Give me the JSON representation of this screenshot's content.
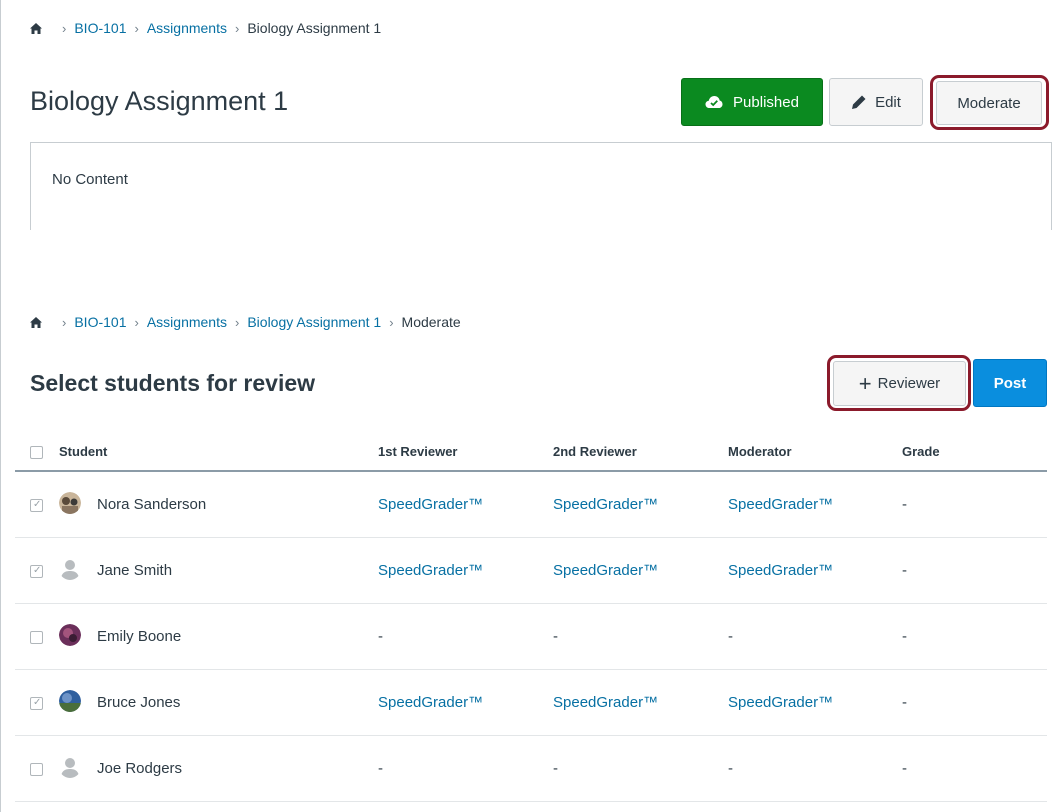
{
  "breadcrumb_top": {
    "items": [
      "BIO-101",
      "Assignments"
    ],
    "current": "Biology Assignment 1"
  },
  "assignment": {
    "title": "Biology Assignment 1",
    "published_label": "Published",
    "edit_label": "Edit",
    "moderate_label": "Moderate",
    "content_text": "No Content"
  },
  "breadcrumb_bottom": {
    "items": [
      "BIO-101",
      "Assignments",
      "Biology Assignment 1"
    ],
    "current": "Moderate"
  },
  "moderate_page": {
    "title": "Select students for review",
    "reviewer_label": "Reviewer",
    "post_label": "Post"
  },
  "table": {
    "headers": [
      "Student",
      "1st Reviewer",
      "2nd Reviewer",
      "Moderator",
      "Grade"
    ],
    "rows": [
      {
        "name": "Nora Sanderson",
        "checked": true,
        "avatar": "photo-avatar",
        "first": "SpeedGrader™",
        "second": "SpeedGrader™",
        "moderator": "SpeedGrader™",
        "grade": "-"
      },
      {
        "name": "Jane Smith",
        "checked": true,
        "avatar": "default-avatar",
        "first": "SpeedGrader™",
        "second": "SpeedGrader™",
        "moderator": "SpeedGrader™",
        "grade": "-"
      },
      {
        "name": "Emily Boone",
        "checked": false,
        "avatar": "photo-avatar",
        "first": "-",
        "second": "-",
        "moderator": "-",
        "grade": "-"
      },
      {
        "name": "Bruce Jones",
        "checked": true,
        "avatar": "photo-avatar",
        "first": "SpeedGrader™",
        "second": "SpeedGrader™",
        "moderator": "SpeedGrader™",
        "grade": "-"
      },
      {
        "name": "Joe Rodgers",
        "checked": false,
        "avatar": "default-avatar",
        "first": "-",
        "second": "-",
        "moderator": "-",
        "grade": "-"
      }
    ]
  },
  "colors": {
    "link": "#0770a3",
    "published": "#0b8a20",
    "post": "#0a8ede",
    "highlight": "#8b1a2b"
  }
}
